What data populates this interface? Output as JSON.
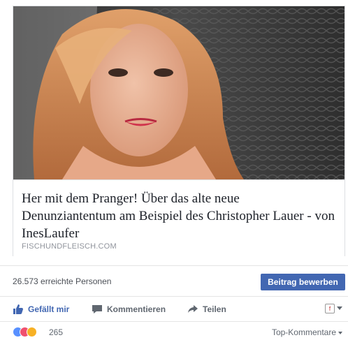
{
  "link_card": {
    "title": "Her mit dem Pranger! Über das alte neue Denunziantentum am Beispiel des Christopher Lauer - von InesLaufer",
    "domain": "FISCHUNDFLEISCH.COM",
    "image_icon": "portrait-photo"
  },
  "reach": {
    "text": "26.573 erreichte Personen",
    "boost_label": "Beitrag bewerben"
  },
  "actions": {
    "like_label": "Gefällt mir",
    "comment_label": "Kommentieren",
    "share_label": "Teilen",
    "like_icon": "thumbs-up-icon",
    "comment_icon": "comment-icon",
    "share_icon": "share-arrow-icon"
  },
  "reactions": {
    "count": "265",
    "sort_label": "Top-Kommentare"
  },
  "colors": {
    "accent": "#4267b2",
    "muted_text": "#606770",
    "border": "#dddfe2"
  }
}
